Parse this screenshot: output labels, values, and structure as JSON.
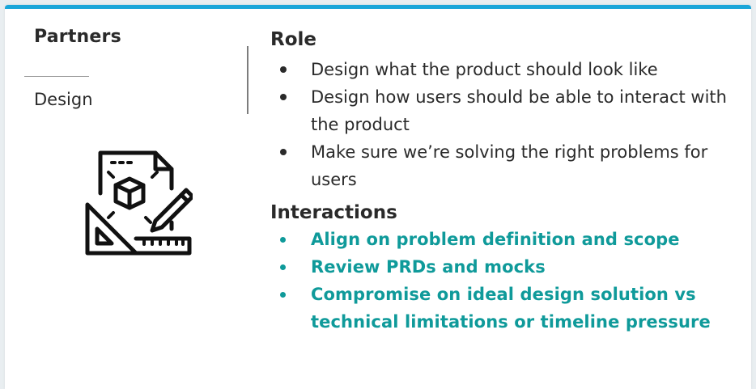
{
  "left": {
    "title": "Partners",
    "partner": "Design",
    "icon": "design-blueprint-icon"
  },
  "role": {
    "heading": "Role",
    "items": [
      {
        "text": "Design what the product should look like"
      },
      {
        "text": "Design how users should be able to interact with the product"
      },
      {
        "text": "Make sure we’re solving the right problems for users"
      }
    ]
  },
  "interactions": {
    "heading": "Interactions",
    "items": [
      {
        "text": "Align on problem definition and scope"
      },
      {
        "text": "Review PRDs and mocks"
      },
      {
        "text": "Compromise on ideal design solution vs technical limitations or timeline pressure"
      }
    ]
  },
  "colors": {
    "accent_top": "#1aa6d9",
    "interactions_text": "#0f9a9a",
    "body_text": "#2a2a2a"
  }
}
